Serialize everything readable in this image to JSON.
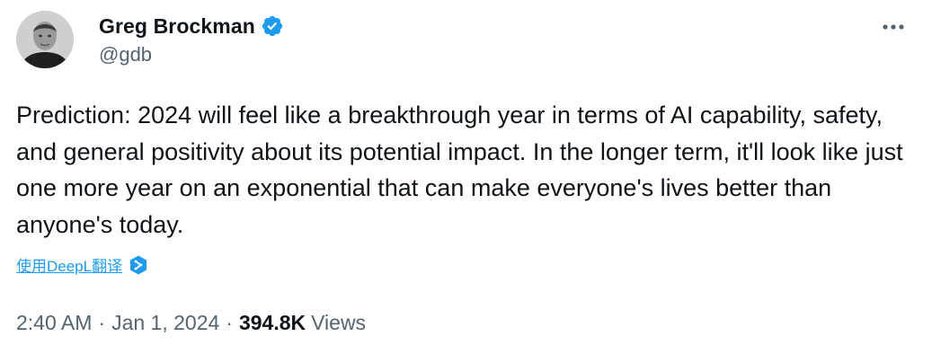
{
  "author": {
    "name": "Greg Brockman",
    "handle": "@gdb",
    "verified": true
  },
  "tweet": {
    "text": "Prediction: 2024 will feel like a breakthrough year in terms of AI capability, safety, and general positivity about its potential impact. In the longer term, it'll look like just one more year on an exponential that can make everyone's lives better than anyone's today."
  },
  "translate": {
    "label": "使用DeepL翻译",
    "icon": "deepl-icon"
  },
  "meta": {
    "time": "2:40 AM",
    "separator": "·",
    "date": "Jan 1, 2024",
    "views_count": "394.8K",
    "views_label": "Views"
  },
  "icons": {
    "more": "more-horizontal-icon",
    "verified": "verified-badge-icon"
  },
  "colors": {
    "text": "#0f1419",
    "secondary": "#536471",
    "accent": "#1d9bf0"
  }
}
